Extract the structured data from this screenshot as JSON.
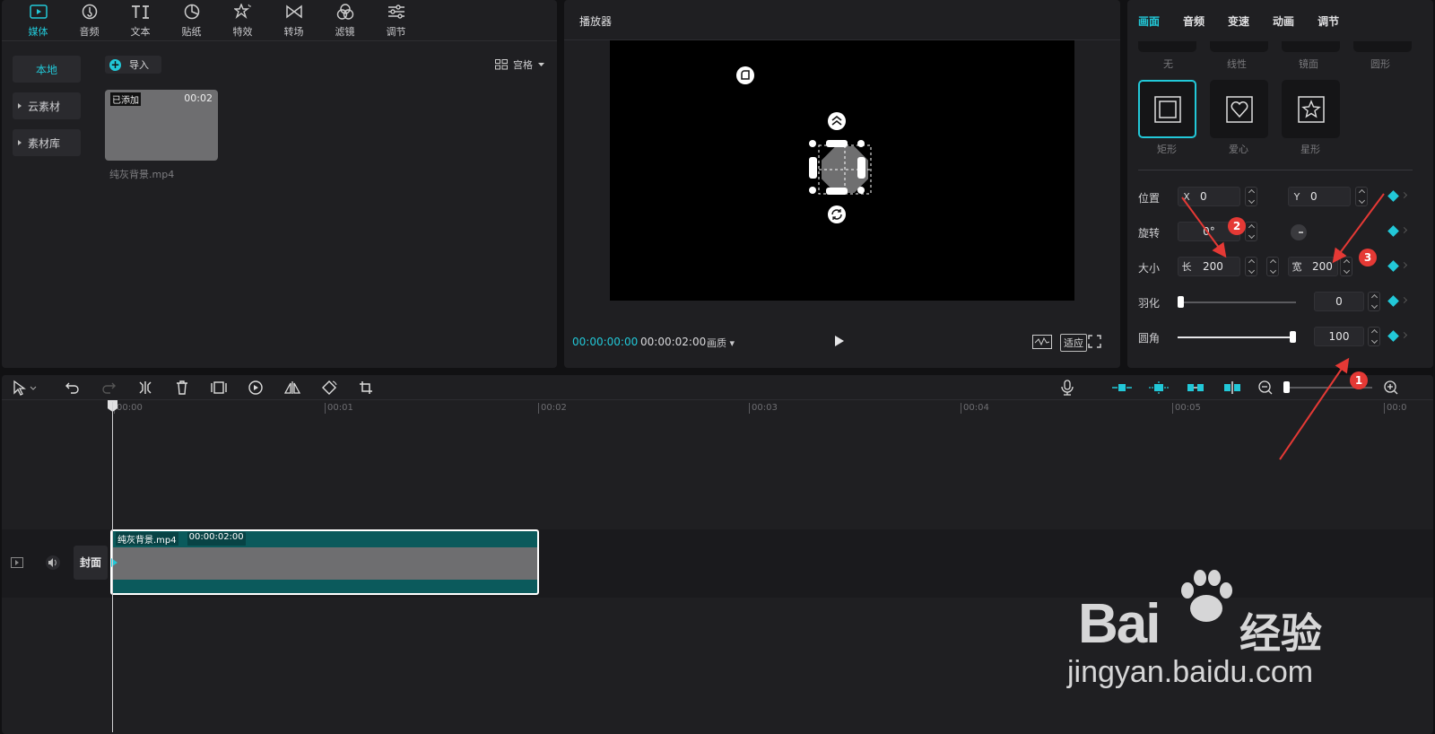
{
  "media": {
    "tabs": [
      {
        "label": "媒体",
        "icon": "media-icon"
      },
      {
        "label": "音频",
        "icon": "audio-icon"
      },
      {
        "label": "文本",
        "icon": "text-icon"
      },
      {
        "label": "贴纸",
        "icon": "sticker-icon"
      },
      {
        "label": "特效",
        "icon": "effects-icon"
      },
      {
        "label": "转场",
        "icon": "transition-icon"
      },
      {
        "label": "滤镜",
        "icon": "filter-icon"
      },
      {
        "label": "调节",
        "icon": "adjust-icon"
      }
    ],
    "sidebar": [
      "本地",
      "云素材",
      "素材库"
    ],
    "import_label": "导入",
    "view_label": "宫格",
    "clip": {
      "badge": "已添加",
      "duration": "00:02",
      "name": "纯灰背景.mp4"
    }
  },
  "player": {
    "title": "播放器",
    "current_time": "00:00:00:00",
    "total_time": "00:00:02:00",
    "quality_label": "画质",
    "fit_label": "适应"
  },
  "props": {
    "tabs": [
      "画面",
      "音频",
      "变速",
      "动画",
      "调节"
    ],
    "mask_row1_labels": [
      "无",
      "线性",
      "镜面",
      "圆形"
    ],
    "mask_row2": [
      {
        "label": "矩形",
        "icon": "rectangle-mask-icon",
        "selected": true
      },
      {
        "label": "爱心",
        "icon": "heart-mask-icon",
        "selected": false
      },
      {
        "label": "星形",
        "icon": "star-mask-icon",
        "selected": false
      }
    ],
    "position": {
      "label": "位置",
      "x_prefix": "X",
      "x": "0",
      "y_prefix": "Y",
      "y": "0"
    },
    "rotation": {
      "label": "旋转",
      "value": "0°"
    },
    "size": {
      "label": "大小",
      "length_prefix": "长",
      "length": "200",
      "width_prefix": "宽",
      "width": "200"
    },
    "feather": {
      "label": "羽化",
      "value": "0",
      "level_percent": 0
    },
    "corner": {
      "label": "圆角",
      "value": "100",
      "level_percent": 100
    },
    "accent": "#22c8d8"
  },
  "annotations": [
    "1",
    "2",
    "3"
  ],
  "timeline": {
    "ruler": [
      "00:00",
      "00:01",
      "00:02",
      "00:03",
      "00:04",
      "00:05",
      "00:0"
    ],
    "clip_name": "纯灰背景.mp4",
    "clip_duration": "00:00:02:00",
    "cover_label": "封面"
  },
  "watermark": {
    "brand": "Baidu",
    "cn": "经验",
    "url": "jingyan.baidu.com"
  }
}
